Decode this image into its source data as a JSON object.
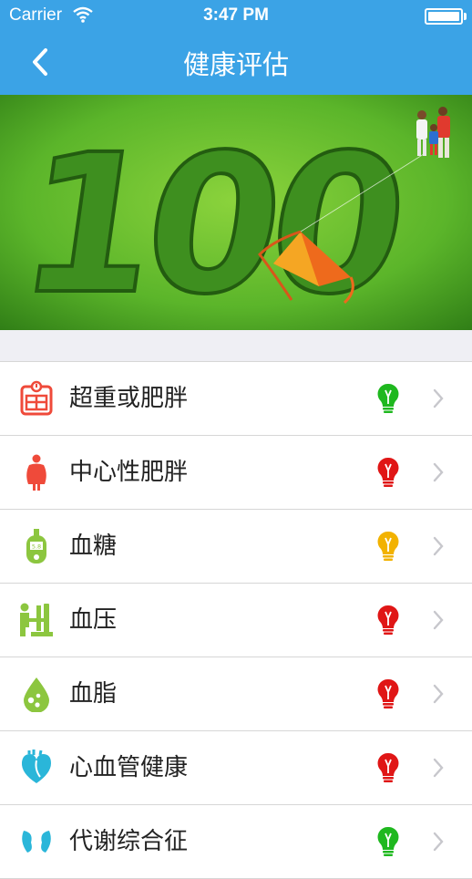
{
  "status_bar": {
    "carrier": "Carrier",
    "time": "3:47 PM"
  },
  "nav": {
    "title": "健康评估"
  },
  "banner": {
    "text": "100"
  },
  "items": [
    {
      "label": "超重或肥胖",
      "icon": "scale-icon",
      "status_color": "#1fb81f"
    },
    {
      "label": "中心性肥胖",
      "icon": "body-icon",
      "status_color": "#e01616"
    },
    {
      "label": "血糖",
      "icon": "glucose-meter-icon",
      "status_color": "#f2b200"
    },
    {
      "label": "血压",
      "icon": "blood-pressure-icon",
      "status_color": "#e01616"
    },
    {
      "label": "血脂",
      "icon": "blood-drop-icon",
      "status_color": "#e01616"
    },
    {
      "label": "心血管健康",
      "icon": "heart-icon",
      "status_color": "#e01616"
    },
    {
      "label": "代谢综合征",
      "icon": "kidney-icon",
      "status_color": "#1fb81f"
    }
  ]
}
